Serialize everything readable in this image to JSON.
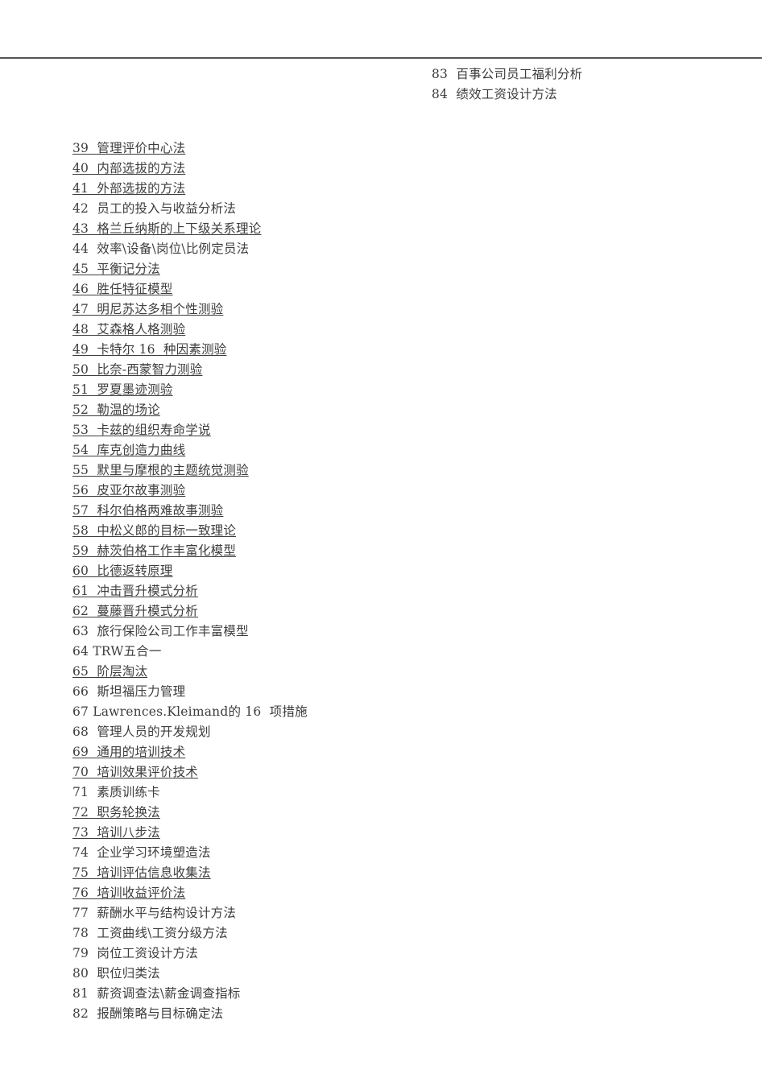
{
  "page": {
    "background_color": "#ffffff",
    "text_color": "#3d3d3d",
    "rule_color": "#555555"
  },
  "header": {
    "rule_visible": true,
    "entries": [
      {
        "number": "83",
        "title": "百事公司员工福利分析",
        "text": "83  百事公司员工福利分析",
        "underlined": false
      },
      {
        "number": "84",
        "title": "绩效工资设计方法",
        "text": "84  绩效工资设计方法",
        "underlined": true
      }
    ]
  },
  "body": {
    "entries": [
      {
        "number": "39",
        "title": "管理评价中心法",
        "text": "39  管理评价中心法",
        "underlined": true
      },
      {
        "number": "40",
        "title": "内部选拔的方法",
        "text": "40  内部选拔的方法",
        "underlined": true
      },
      {
        "number": "41",
        "title": "外部选拔的方法",
        "text": "41  外部选拔的方法",
        "underlined": true
      },
      {
        "number": "42",
        "title": "员工的投入与收益分析法",
        "text": "42  员工的投入与收益分析法",
        "underlined": false
      },
      {
        "number": "43",
        "title": "格兰丘纳斯的上下级关系理论",
        "text": "43  格兰丘纳斯的上下级关系理论",
        "underlined": true
      },
      {
        "number": "44",
        "title": "效率\\设备\\岗位\\比例定员法",
        "text": "44  效率\\设备\\岗位\\比例定员法",
        "underlined": false
      },
      {
        "number": "45",
        "title": "平衡记分法",
        "text": "45  平衡记分法",
        "underlined": true
      },
      {
        "number": "46",
        "title": "胜任特征模型",
        "text": "46  胜任特征模型",
        "underlined": true
      },
      {
        "number": "47",
        "title": "明尼苏达多相个性测验",
        "text": "47  明尼苏达多相个性测验",
        "underlined": true
      },
      {
        "number": "48",
        "title": "艾森格人格测验",
        "text": "48  艾森格人格测验",
        "underlined": true
      },
      {
        "number": "49",
        "title": "卡特尔 16 种因素测验",
        "text": "49  卡特尔 16  种因素测验",
        "underlined": true
      },
      {
        "number": "50",
        "title": "比奈-西蒙智力测验",
        "text": "50  比奈-西蒙智力测验",
        "underlined": true
      },
      {
        "number": "51",
        "title": "罗夏墨迹测验",
        "text": "51  罗夏墨迹测验",
        "underlined": true
      },
      {
        "number": "52",
        "title": "勒温的场论",
        "text": "52  勒温的场论",
        "underlined": true
      },
      {
        "number": "53",
        "title": "卡兹的组织寿命学说",
        "text": "53  卡兹的组织寿命学说",
        "underlined": true
      },
      {
        "number": "54",
        "title": "库克创造力曲线",
        "text": "54  库克创造力曲线",
        "underlined": true
      },
      {
        "number": "55",
        "title": "默里与摩根的主题统觉测验",
        "text": "55  默里与摩根的主题统觉测验",
        "underlined": true
      },
      {
        "number": "56",
        "title": "皮亚尔故事测验",
        "text": "56  皮亚尔故事测验",
        "underlined": true
      },
      {
        "number": "57",
        "title": "科尔伯格两难故事测验",
        "text": "57  科尔伯格两难故事测验",
        "underlined": true
      },
      {
        "number": "58",
        "title": "中松义郎的目标一致理论",
        "text": "58  中松义郎的目标一致理论",
        "underlined": true
      },
      {
        "number": "59",
        "title": "赫茨伯格工作丰富化模型",
        "text": "59  赫茨伯格工作丰富化模型",
        "underlined": true
      },
      {
        "number": "60",
        "title": "比德返转原理",
        "text": "60  比德返转原理",
        "underlined": true
      },
      {
        "number": "61",
        "title": "冲击晋升模式分析",
        "text": "61  冲击晋升模式分析",
        "underlined": true
      },
      {
        "number": "62",
        "title": "蔓藤晋升模式分析",
        "text": "62  蔓藤晋升模式分析",
        "underlined": true
      },
      {
        "number": "63",
        "title": "旅行保险公司工作丰富模型",
        "text": "63  旅行保险公司工作丰富模型",
        "underlined": false
      },
      {
        "number": "64",
        "title": "TRW五合一",
        "text": "64 TRW五合一",
        "underlined": false
      },
      {
        "number": "65",
        "title": "阶层淘汰",
        "text": "65  阶层淘汰",
        "underlined": true
      },
      {
        "number": "66",
        "title": "斯坦福压力管理",
        "text": "66  斯坦福压力管理",
        "underlined": false
      },
      {
        "number": "67",
        "title": "Lawrences.Kleimand的 16 项措施",
        "text": "67 Lawrences.Kleimand的 16  项措施",
        "underlined": false
      },
      {
        "number": "68",
        "title": "管理人员的开发规划",
        "text": "68  管理人员的开发规划",
        "underlined": false
      },
      {
        "number": "69",
        "title": "通用的培训技术",
        "text": "69  通用的培训技术",
        "underlined": true
      },
      {
        "number": "70",
        "title": "培训效果评价技术",
        "text": "70  培训效果评价技术",
        "underlined": true
      },
      {
        "number": "71",
        "title": "素质训练卡",
        "text": "71  素质训练卡",
        "underlined": false
      },
      {
        "number": "72",
        "title": "职务轮换法",
        "text": "72  职务轮换法",
        "underlined": true
      },
      {
        "number": "73",
        "title": "培训八步法",
        "text": "73  培训八步法",
        "underlined": true
      },
      {
        "number": "74",
        "title": "企业学习环境塑造法",
        "text": "74  企业学习环境塑造法",
        "underlined": false
      },
      {
        "number": "75",
        "title": "培训评估信息收集法",
        "text": "75  培训评估信息收集法",
        "underlined": true
      },
      {
        "number": "76",
        "title": "培训收益评价法",
        "text": "76  培训收益评价法",
        "underlined": true
      },
      {
        "number": "77",
        "title": "薪酬水平与结构设计方法",
        "text": "77  薪酬水平与结构设计方法",
        "underlined": false
      },
      {
        "number": "78",
        "title": "工资曲线\\工资分级方法",
        "text": "78  工资曲线\\工资分级方法",
        "underlined": false
      },
      {
        "number": "79",
        "title": "岗位工资设计方法",
        "text": "79  岗位工资设计方法",
        "underlined": false
      },
      {
        "number": "80",
        "title": "职位归类法",
        "text": "80  职位归类法",
        "underlined": false
      },
      {
        "number": "81",
        "title": "薪资调查法\\薪金调查指标",
        "text": "81  薪资调查法\\薪金调查指标",
        "underlined": false
      },
      {
        "number": "82",
        "title": "报酬策略与目标确定法",
        "text": "82  报酬策略与目标确定法",
        "underlined": false
      }
    ]
  }
}
